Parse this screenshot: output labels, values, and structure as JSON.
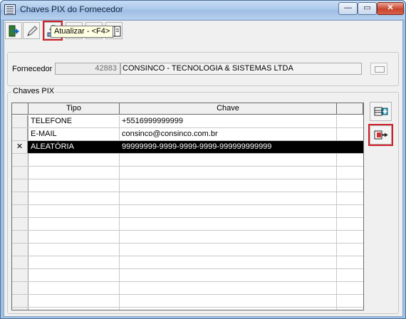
{
  "window": {
    "title": "Chaves PIX do Fornecedor",
    "min_glyph": "—",
    "max_glyph": "▭",
    "close_glyph": "✕"
  },
  "toolbar": {
    "buttons": [
      {
        "icon": "exit-door-icon"
      },
      {
        "icon": "pencil-icon"
      },
      {
        "icon": "refresh-download-icon",
        "highlighted": true
      },
      {
        "icon": "binoculars-icon"
      },
      {
        "icon": "help-icon",
        "label": "?"
      },
      {
        "icon": "book-icon"
      }
    ],
    "tooltip": "Atualizar - <F4>"
  },
  "fornecedor": {
    "label": "Fornecedor",
    "code": "42883",
    "name": "CONSINCO - TECNOLOGIA & SISTEMAS LTDA"
  },
  "pix": {
    "group_title": "Chaves PIX",
    "columns": [
      "Tipo",
      "Chave"
    ],
    "rows": [
      {
        "indicator": "",
        "tipo": "TELEFONE",
        "chave": "+5516999999999",
        "selected": false
      },
      {
        "indicator": "",
        "tipo": "E-MAIL",
        "chave": "consinco@consinco.com.br",
        "selected": false
      },
      {
        "indicator": "✕",
        "tipo": "ALEATÓRIA",
        "chave": "99999999-9999-9999-9999-999999999999",
        "selected": true
      }
    ]
  },
  "colors": {
    "highlight": "#d0202a",
    "selected_row": "#000000",
    "titlebar": "#a9c7ea"
  }
}
